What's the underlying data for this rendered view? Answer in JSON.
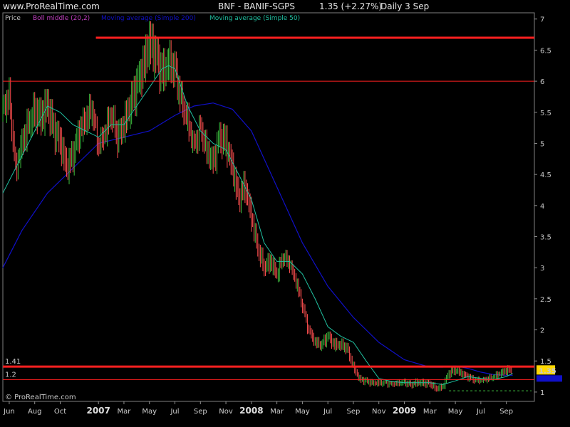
{
  "header": {
    "site": "www.ProRealTime.com",
    "ticker": "BNF - BANIF-SGPS",
    "price_change": "1.35 (+2.27%)",
    "period": "Daily  3 Sep"
  },
  "watermark": "© ProRealTime.com",
  "colors": {
    "background": "#000000",
    "plot_bg": "#000000",
    "frame": "#808080",
    "candle_up": "#3fbf3f",
    "candle_down": "#ff4f4f",
    "ma200": "#1010c8",
    "ma50": "#20c0a0",
    "boll": "#c040c0",
    "resistance": "#ff2020",
    "price_box": "#ffd800",
    "support_dashed": "#40c040"
  },
  "chart_data": {
    "type": "line",
    "title": "BNF - BANIF-SGPS",
    "ylim": [
      0.85,
      7.1
    ],
    "yticks": [
      1,
      1.5,
      2,
      2.5,
      3,
      3.5,
      4,
      4.5,
      5,
      5.5,
      6,
      6.5,
      7
    ],
    "ytick_labels": [
      "1",
      "1.5",
      "2",
      "2.5",
      "3",
      "3.5",
      "4",
      "4.5",
      "5",
      "5.5",
      "6",
      "6.5",
      "7"
    ],
    "x_labels": [
      {
        "label": "Jun",
        "t": 0.0,
        "year": false
      },
      {
        "label": "Aug",
        "t": 2.0,
        "year": false
      },
      {
        "label": "Oct",
        "t": 4.0,
        "year": false
      },
      {
        "label": "2007",
        "t": 7.0,
        "year": true
      },
      {
        "label": "Mar",
        "t": 9.0,
        "year": false
      },
      {
        "label": "May",
        "t": 11.0,
        "year": false
      },
      {
        "label": "Jul",
        "t": 13.0,
        "year": false
      },
      {
        "label": "Sep",
        "t": 15.0,
        "year": false
      },
      {
        "label": "Nov",
        "t": 17.0,
        "year": false
      },
      {
        "label": "2008",
        "t": 19.0,
        "year": true
      },
      {
        "label": "Mar",
        "t": 21.0,
        "year": false
      },
      {
        "label": "May",
        "t": 23.0,
        "year": false
      },
      {
        "label": "Jul",
        "t": 25.0,
        "year": false
      },
      {
        "label": "Sep",
        "t": 27.0,
        "year": false
      },
      {
        "label": "Nov",
        "t": 29.0,
        "year": false
      },
      {
        "label": "2009",
        "t": 31.0,
        "year": true
      },
      {
        "label": "Mar",
        "t": 33.0,
        "year": false
      },
      {
        "label": "May",
        "t": 35.0,
        "year": false
      },
      {
        "label": "Jul",
        "t": 37.0,
        "year": false
      },
      {
        "label": "Sep",
        "t": 39.0,
        "year": false
      }
    ],
    "xlim": [
      -0.5,
      41.2
    ],
    "legend": [
      {
        "name": "Price",
        "color": "#c8c8c8"
      },
      {
        "name": "Boll middle (20,2)",
        "color": "#c040c0"
      },
      {
        "name": "Moving average (Simple 200)",
        "color": "#1010c8"
      },
      {
        "name": "Moving average (Simple 50)",
        "color": "#20c0a0"
      }
    ],
    "price": {
      "t": [
        -0.5,
        0.0,
        0.5,
        1.0,
        1.5,
        2.0,
        2.5,
        3.0,
        3.5,
        4.0,
        4.5,
        5.0,
        5.5,
        6.0,
        6.5,
        7.0,
        7.5,
        8.0,
        8.5,
        9.0,
        9.5,
        10.0,
        10.5,
        11.0,
        11.5,
        12.0,
        12.5,
        13.0,
        13.5,
        14.0,
        14.5,
        15.0,
        15.5,
        16.0,
        16.5,
        17.0,
        17.5,
        18.0,
        18.5,
        19.0,
        19.5,
        20.0,
        20.5,
        21.0,
        21.5,
        22.0,
        22.5,
        23.0,
        23.5,
        24.0,
        24.5,
        25.0,
        25.5,
        26.0,
        26.5,
        27.0,
        27.5,
        28.0,
        28.5,
        29.0,
        29.5,
        30.0,
        30.5,
        31.0,
        31.5,
        32.0,
        32.5,
        33.0,
        33.5,
        34.0,
        34.5,
        35.0,
        35.5,
        36.0,
        36.5,
        37.0,
        37.5,
        38.0,
        38.5,
        39.0,
        39.5
      ],
      "v": [
        5.6,
        5.8,
        4.6,
        5.0,
        5.3,
        5.5,
        5.4,
        5.6,
        5.2,
        5.0,
        4.6,
        4.8,
        5.2,
        5.4,
        5.6,
        5.0,
        5.2,
        5.5,
        5.1,
        5.3,
        5.6,
        5.9,
        6.2,
        6.6,
        6.4,
        6.1,
        6.3,
        6.2,
        5.7,
        5.4,
        5.0,
        5.3,
        4.9,
        4.7,
        5.1,
        5.0,
        4.6,
        4.1,
        4.3,
        3.8,
        3.3,
        3.0,
        3.1,
        2.9,
        3.2,
        3.1,
        2.8,
        2.4,
        2.0,
        1.8,
        1.75,
        1.9,
        1.75,
        1.75,
        1.7,
        1.4,
        1.2,
        1.18,
        1.15,
        1.15,
        1.16,
        1.14,
        1.15,
        1.16,
        1.12,
        1.15,
        1.14,
        1.13,
        1.05,
        1.08,
        1.3,
        1.35,
        1.3,
        1.25,
        1.2,
        1.2,
        1.22,
        1.25,
        1.3,
        1.35,
        1.35
      ]
    },
    "ma50": {
      "t": [
        -0.5,
        1.0,
        2.0,
        3.0,
        4.0,
        5.0,
        6.0,
        7.0,
        8.0,
        9.0,
        10.0,
        11.0,
        12.0,
        12.5,
        13.0,
        13.5,
        14.0,
        15.0,
        16.0,
        17.0,
        18.0,
        19.0,
        20.0,
        21.0,
        22.0,
        23.0,
        24.0,
        25.0,
        26.0,
        27.0,
        28.0,
        29.0,
        30.0,
        31.0,
        32.0,
        33.0,
        34.0,
        35.0,
        36.0,
        37.0,
        38.0,
        39.0,
        39.5
      ],
      "v": [
        4.2,
        4.8,
        5.2,
        5.6,
        5.5,
        5.3,
        5.2,
        5.1,
        5.3,
        5.3,
        5.6,
        5.9,
        6.2,
        6.25,
        6.2,
        5.9,
        5.6,
        5.2,
        5.0,
        4.9,
        4.5,
        4.1,
        3.4,
        3.1,
        3.1,
        2.9,
        2.5,
        2.05,
        1.9,
        1.8,
        1.5,
        1.22,
        1.17,
        1.15,
        1.15,
        1.15,
        1.12,
        1.18,
        1.25,
        1.22,
        1.2,
        1.25,
        1.3
      ]
    },
    "ma200": {
      "t": [
        -0.5,
        1.0,
        3.0,
        5.0,
        7.0,
        9.0,
        11.0,
        13.0,
        14.5,
        16.0,
        17.5,
        19.0,
        21.0,
        23.0,
        25.0,
        27.0,
        29.0,
        31.0,
        33.0,
        34.0,
        35.0,
        36.0,
        37.0,
        38.0,
        39.0,
        39.5
      ],
      "v": [
        3.0,
        3.6,
        4.2,
        4.6,
        5.0,
        5.1,
        5.2,
        5.45,
        5.6,
        5.65,
        5.55,
        5.2,
        4.3,
        3.4,
        2.7,
        2.2,
        1.8,
        1.52,
        1.4,
        1.4,
        1.42,
        1.38,
        1.32,
        1.28,
        1.27,
        1.27
      ]
    },
    "hlines": [
      {
        "name": "resistance-top",
        "value": 6.7,
        "from_t": 6.8,
        "width": 3
      },
      {
        "name": "resistance-6",
        "value": 6.0,
        "from_t": -0.5,
        "width": 1
      },
      {
        "name": "resistance-1.41",
        "value": 1.41,
        "from_t": -0.5,
        "width": 3
      },
      {
        "name": "support-1.2",
        "value": 1.2,
        "from_t": -0.5,
        "width": 1
      }
    ],
    "annotations": [
      {
        "label": "1.41",
        "value": 1.41
      },
      {
        "label": "1.2",
        "value": 1.2
      }
    ],
    "last_price_label": "1.35",
    "last_price_value": 1.35
  }
}
